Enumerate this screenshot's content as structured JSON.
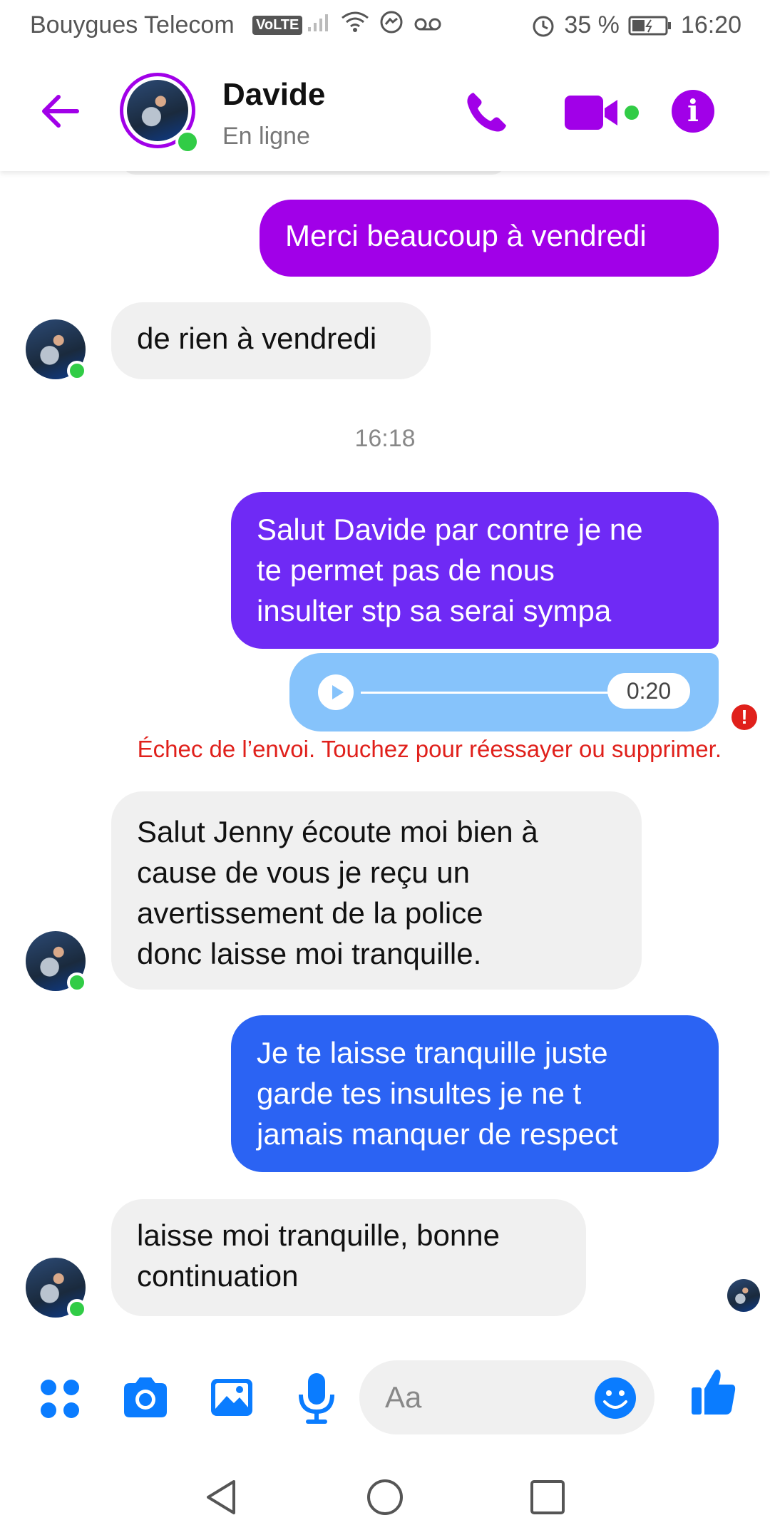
{
  "status_bar": {
    "carrier": "Bouygues Telecom",
    "volte": "VoLTE",
    "battery": "35 %",
    "time": "16:20"
  },
  "header": {
    "contact_name": "Davide",
    "presence": "En ligne",
    "accent": "#a100e8"
  },
  "messages": [
    {
      "id": "m1",
      "direction": "outgoing",
      "text": "Merci beaucoup à vendredi"
    },
    {
      "id": "m2",
      "direction": "incoming",
      "text": "de rien à vendredi"
    },
    {
      "id": "ts",
      "type": "timestamp",
      "text": "16:18"
    },
    {
      "id": "m3",
      "direction": "outgoing",
      "lines": [
        "Salut Davide par contre je ne",
        "te permet pas de nous",
        "insulter stp sa serai sympa"
      ]
    },
    {
      "id": "m4",
      "direction": "outgoing",
      "type": "audio",
      "duration": "0:20",
      "error": "Échec de l’envoi. Touchez pour réessayer ou supprimer."
    },
    {
      "id": "m5",
      "direction": "incoming",
      "lines": [
        "Salut Jenny écoute moi bien à",
        "cause  de vous je reçu un",
        "avertissement de la police",
        "donc laisse moi tranquille."
      ]
    },
    {
      "id": "m6",
      "direction": "outgoing",
      "lines": [
        "Je te laisse tranquille juste",
        "garde tes insultes je ne t",
        "jamais manquer de respect"
      ]
    },
    {
      "id": "m7",
      "direction": "incoming",
      "lines": [
        "laisse moi tranquille,  bonne",
        "continuation"
      ]
    }
  ],
  "composer": {
    "placeholder": "Aa",
    "icons": [
      "apps-icon",
      "camera-icon",
      "gallery-icon",
      "mic-icon",
      "emoji-icon",
      "like-icon"
    ]
  },
  "colors": {
    "outgoing_purple": "#a100e8",
    "outgoing_violet": "#6f2af5",
    "outgoing_blue": "#2b63f3",
    "messenger_blue": "#0a7cff",
    "online_green": "#31cc46",
    "error_red": "#e0201b"
  }
}
